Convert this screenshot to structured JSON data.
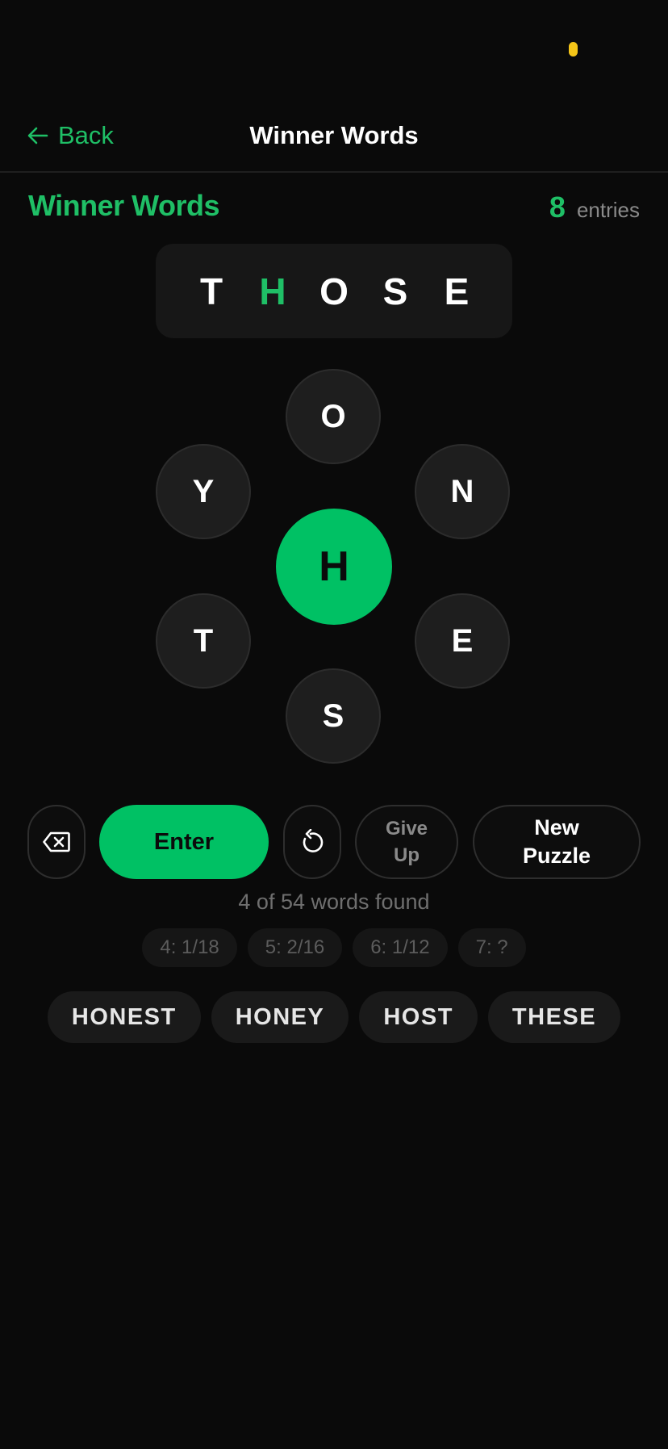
{
  "nav": {
    "back_label": "Back",
    "title": "Winner Words"
  },
  "header": {
    "game_title": "Winner Words",
    "entries_count": "8",
    "entries_label": "entries"
  },
  "current_word": {
    "letters": [
      "T",
      "H",
      "O",
      "S",
      "E"
    ]
  },
  "hive": {
    "center": "H",
    "outer": {
      "top": "O",
      "upper_left": "Y",
      "upper_right": "N",
      "lower_left": "T",
      "lower_right": "E",
      "bottom": "S"
    }
  },
  "controls": {
    "enter_label": "Enter",
    "give_up_label": "Give\nUp",
    "new_puzzle_label": "New\nPuzzle"
  },
  "progress": {
    "text": "4 of 54 words found"
  },
  "length_counts": [
    "4: 1/18",
    "5: 2/16",
    "6: 1/12",
    "7: ?"
  ],
  "found_words": [
    "HONEST",
    "HONEY",
    "HOST",
    "THESE"
  ],
  "colors": {
    "accent": "#00c164",
    "background": "#0a0a0a",
    "status_indicator": "#f5c518"
  },
  "icons": {
    "back": "arrow-left-icon",
    "delete": "backspace-icon",
    "shuffle": "rotate-icon"
  }
}
